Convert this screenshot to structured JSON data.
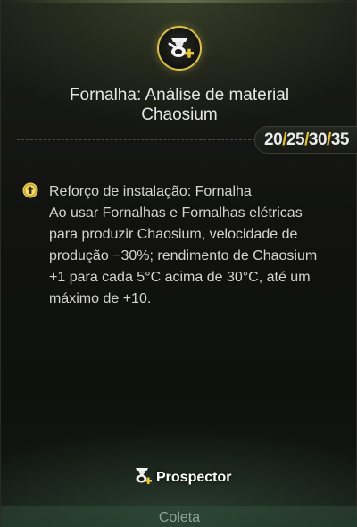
{
  "header": {
    "emblem_icon": "prospector-tool-plus-icon",
    "title_line1": "Fornalha: Análise de material",
    "title_line2": "Chaosium"
  },
  "levels": {
    "values": [
      "20",
      "25",
      "30",
      "35"
    ],
    "separator": "/",
    "separator_color": "#e3c23a"
  },
  "effect": {
    "icon": "arrow-up-circle-icon",
    "text": "Reforço de instalação: Fornalha\nAo usar Fornalhas e Fornalhas elétricas para produzir Chaosium, velocidade de produção −30%; rendimento de Chaosium +1 para cada 5°C acima de 30°C, até um máximo de +10."
  },
  "footer": {
    "badge_icon": "prospector-icon",
    "badge_label": "Prospector",
    "tab_label": "Coleta"
  },
  "colors": {
    "accent_gold": "#d9c14a",
    "text": "#d4d4d4"
  }
}
